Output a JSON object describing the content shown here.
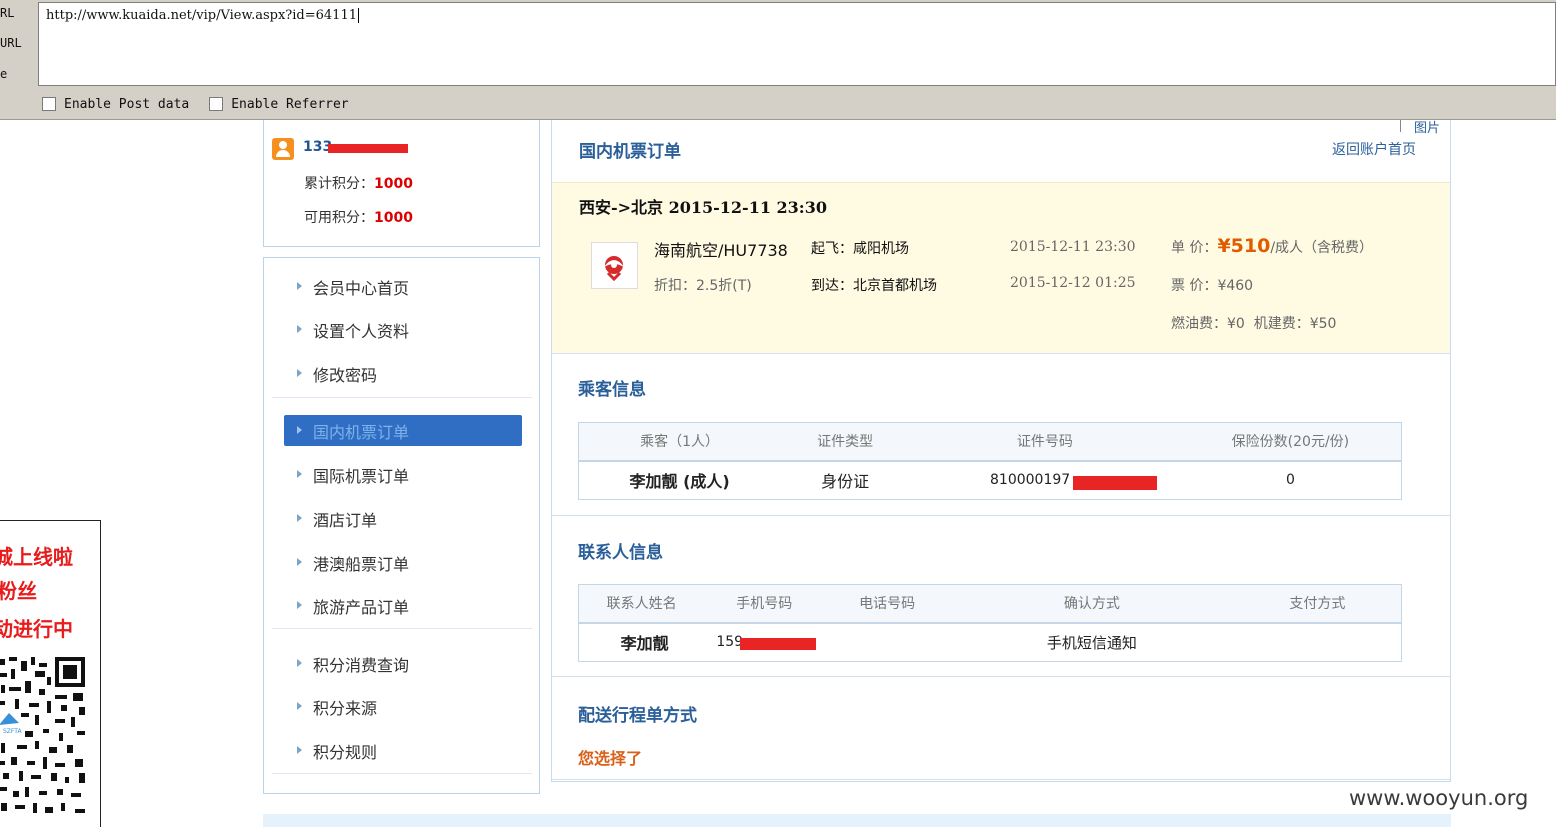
{
  "hackbar": {
    "labels": [
      "RL",
      "URL",
      "e"
    ],
    "url": "http://www.kuaida.net/vip/View.aspx?id=64111",
    "options": [
      "Enable Post data",
      "Enable Referrer"
    ]
  },
  "ad": {
    "lines": [
      "城上线啦",
      "粉丝",
      "动进行中"
    ],
    "qr_text": "SZFTA"
  },
  "user": {
    "name_prefix": "133",
    "total_points_label": "累计积分：",
    "total_points": "1000",
    "available_points_label": "可用积分：",
    "available_points": "1000"
  },
  "nav": {
    "items": [
      {
        "label": "会员中心首页"
      },
      {
        "label": "设置个人资料"
      },
      {
        "label": "修改密码"
      },
      {
        "label": "国内机票订单",
        "active": true
      },
      {
        "label": "国际机票订单"
      },
      {
        "label": "酒店订单"
      },
      {
        "label": "港澳船票订单"
      },
      {
        "label": "旅游产品订单"
      },
      {
        "label": "积分消费查询"
      },
      {
        "label": "积分来源"
      },
      {
        "label": "积分规则"
      }
    ]
  },
  "main": {
    "corner_text": "图片",
    "title": "国内机票订单",
    "back_link": "返回账户首页",
    "route": "西安->北京 2015-12-11 23:30",
    "flight": {
      "airline": "海南航空/HU7738",
      "discount": "折扣：2.5折(T)",
      "depart": "起飞：咸阳机场",
      "arrive": "到达：北京首都机场",
      "depart_time": "2015-12-11 23:30",
      "arrive_time": "2015-12-12 01:25",
      "unit_price_label": "单 价：",
      "unit_price": "¥510",
      "unit_price_suffix": "/成人（含税费）",
      "ticket_price": "票 价：¥460",
      "fees": "燃油费：¥0  机建费：¥50"
    },
    "passenger": {
      "title": "乘客信息",
      "headers": [
        "乘客（1人）",
        "证件类型",
        "证件号码",
        "保险份数(20元/份)"
      ],
      "row": [
        "李加靓 (成人)",
        "身份证",
        "810000197",
        "0"
      ]
    },
    "contact": {
      "title": "联系人信息",
      "headers": [
        "联系人姓名",
        "手机号码",
        "电话号码",
        "确认方式",
        "支付方式"
      ],
      "row": [
        "李加靓",
        "159",
        "",
        "手机短信通知",
        ""
      ]
    },
    "delivery": {
      "title": "配送行程单方式",
      "choice": "您选择了"
    }
  },
  "watermark": "www.wooyun.org",
  "colors": {
    "link_blue": "#2b5f9a",
    "points_red": "#dd0000",
    "price_orange": "#e05a00",
    "active_nav": "#2f6ec2",
    "flight_bg": "#fffbe3",
    "redaction": "#e82424"
  }
}
